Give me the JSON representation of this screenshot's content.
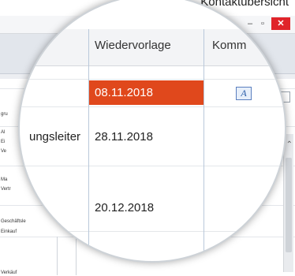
{
  "window": {
    "title": "Kontaktübersicht",
    "minimize_symbol": "–",
    "maximize_symbol": "▫",
    "close_symbol": "✕"
  },
  "background_labels": {
    "row_gru": "gru",
    "row_al": "Al",
    "row_ei": "Ei",
    "row_ve": "Ve",
    "row_ma": "Ma",
    "row_vertr": "Vertr",
    "row_geschaeftsl": "Geschäftsle",
    "row_einkauf": "Einkauf",
    "row_verk": "Verkäuf"
  },
  "table": {
    "columns": {
      "wiedervorlage": "Wiedervorlage",
      "kommentar": "Komm"
    },
    "rows": [
      {
        "role": "",
        "date": "08.11.2018",
        "highlight": true,
        "kommentar_icon": "A"
      },
      {
        "role": "ungsleiter",
        "date": "28.11.2018",
        "highlight": false
      },
      {
        "role": "",
        "date": "20.12.2018",
        "highlight": false
      }
    ]
  },
  "colors": {
    "highlight": "#e0481c",
    "close_button": "#e0242a",
    "accent_line": "#b9c8da"
  },
  "icons": {
    "comment": "text-edit-icon",
    "scroll_up": "chevron-up-icon"
  }
}
